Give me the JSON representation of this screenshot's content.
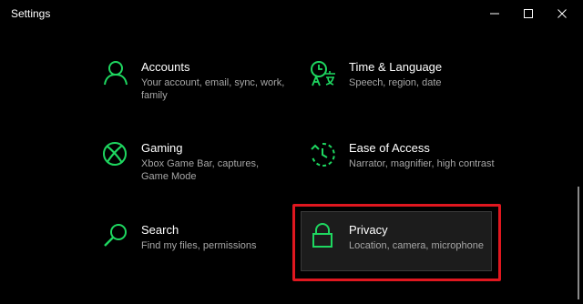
{
  "window": {
    "title": "Settings",
    "controls": {
      "minimize": "minimize-icon",
      "maximize": "maximize-icon",
      "close": "close-icon"
    }
  },
  "accent_color": "#1ed760",
  "highlight_color": "#e0171f",
  "tiles": [
    {
      "title": "Accounts",
      "description": "Your account, email, sync, work, family",
      "icon": "person-icon"
    },
    {
      "title": "Time & Language",
      "description": "Speech, region, date",
      "icon": "time-language-icon"
    },
    {
      "title": "Gaming",
      "description": "Xbox Game Bar, captures, Game Mode",
      "icon": "xbox-icon"
    },
    {
      "title": "Ease of Access",
      "description": "Narrator, magnifier, high contrast",
      "icon": "ease-of-access-icon"
    },
    {
      "title": "Search",
      "description": "Find my files, permissions",
      "icon": "search-icon"
    },
    {
      "title": "Privacy",
      "description": "Location, camera, microphone",
      "icon": "lock-icon",
      "selected": true
    }
  ]
}
